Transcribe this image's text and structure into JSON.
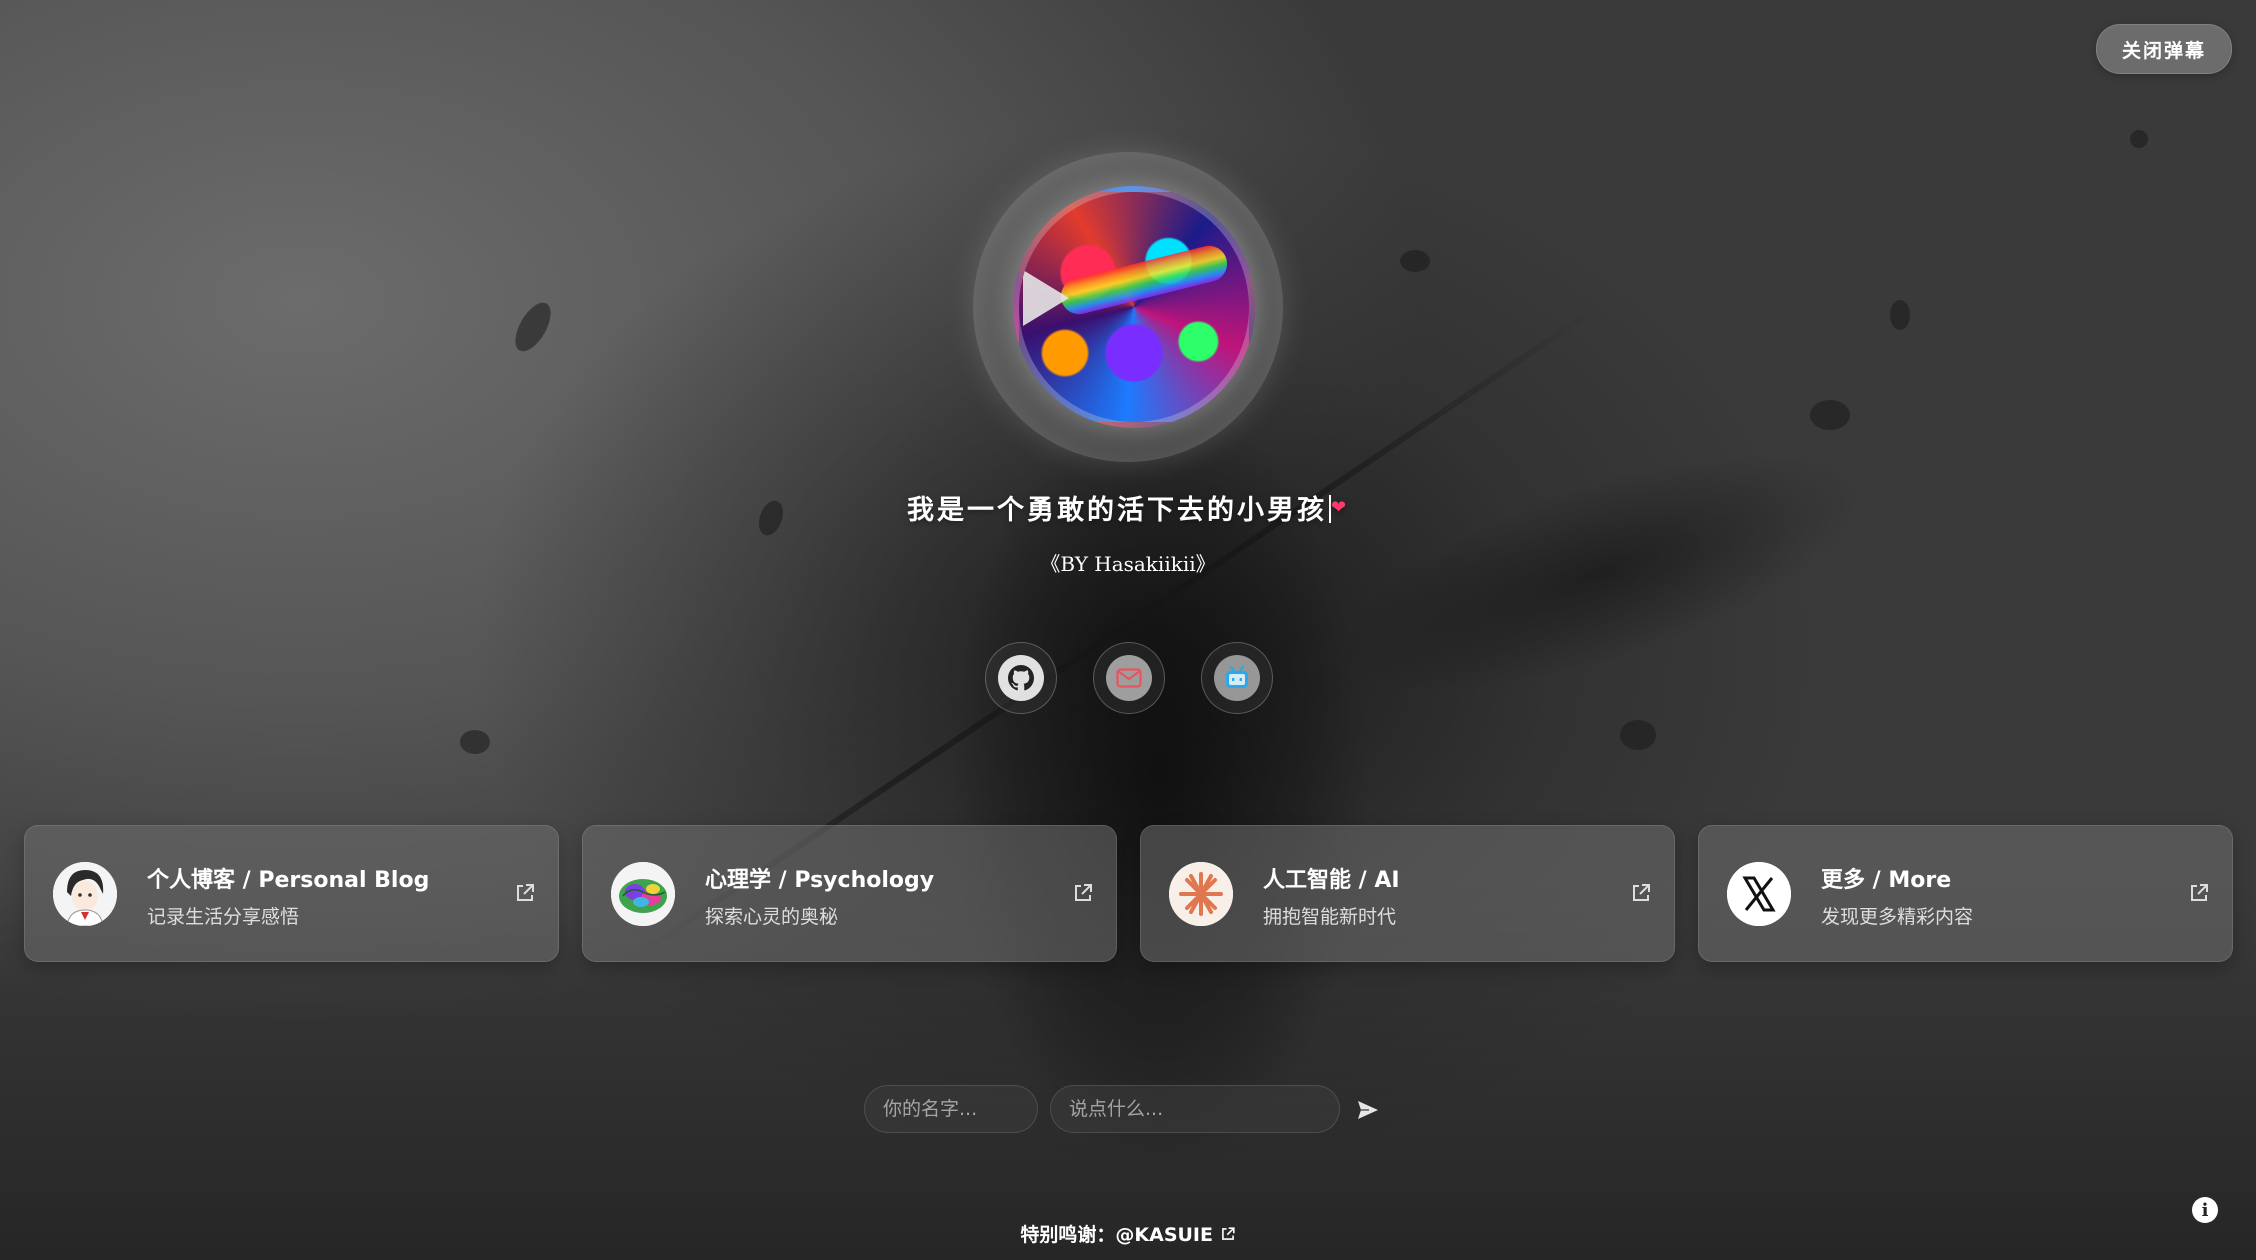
{
  "danmaku": {
    "close_label": "关闭弹幕"
  },
  "profile": {
    "headline": "我是一个勇敢的活下去的小男孩",
    "byline": "《BY Hasakiikii》"
  },
  "social": [
    {
      "name": "github",
      "icon": "github-icon"
    },
    {
      "name": "email",
      "icon": "mail-icon"
    },
    {
      "name": "bilibili",
      "icon": "bilibili-icon"
    }
  ],
  "cards": [
    {
      "title": "个人博客 / Personal Blog",
      "subtitle": "记录生活分享感悟",
      "icon": "blog-avatar-icon"
    },
    {
      "title": "心理学 / Psychology",
      "subtitle": "探索心灵的奥秘",
      "icon": "brain-icon"
    },
    {
      "title": "人工智能 / AI",
      "subtitle": "拥抱智能新时代",
      "icon": "claude-spark-icon"
    },
    {
      "title": "更多 / More",
      "subtitle": "发现更多精彩内容",
      "icon": "x-logo-icon"
    }
  ],
  "message_form": {
    "name_placeholder": "你的名字...",
    "message_placeholder": "说点什么..."
  },
  "footer": {
    "credits_prefix": "特别鸣谢：",
    "credits_link": "@KASUIE"
  },
  "colors": {
    "accent_heart": "#ff3a6a",
    "mail_icon": "#e8555f",
    "bilibili_icon": "#2ea8e6",
    "ai_logo": "#e0774f"
  }
}
